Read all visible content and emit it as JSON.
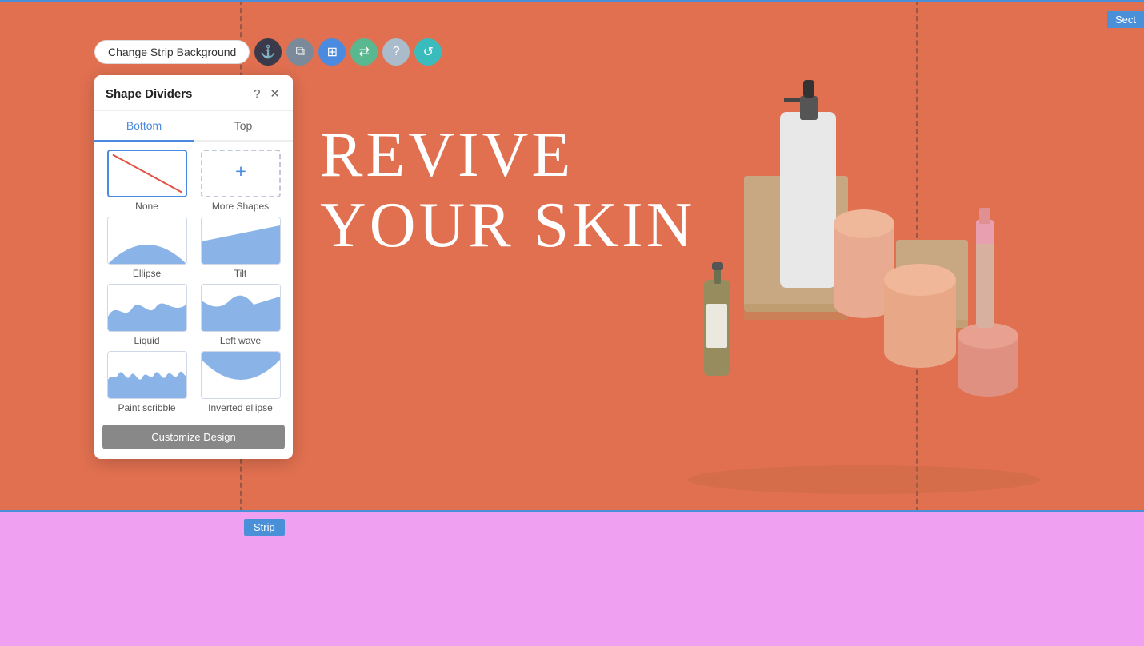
{
  "toolbar": {
    "change_background_label": "Change Strip Background",
    "icons": [
      {
        "name": "anchor-icon",
        "symbol": "⚓",
        "class": "icon-dark"
      },
      {
        "name": "copy-icon",
        "symbol": "⧉",
        "class": "icon-gray"
      },
      {
        "name": "crop-icon",
        "symbol": "⊞",
        "class": "icon-blue"
      },
      {
        "name": "swap-icon",
        "symbol": "⇄",
        "class": "icon-green"
      },
      {
        "name": "help-icon",
        "symbol": "?",
        "class": "icon-light-gray"
      },
      {
        "name": "refresh-icon",
        "symbol": "↺",
        "class": "icon-teal"
      }
    ]
  },
  "panel": {
    "title": "Shape Dividers",
    "tabs": [
      {
        "label": "Bottom",
        "active": true
      },
      {
        "label": "Top",
        "active": false
      }
    ],
    "shapes": [
      {
        "id": "none",
        "label": "None",
        "selected": true,
        "type": "none"
      },
      {
        "id": "more-shapes",
        "label": "More Shapes",
        "selected": false,
        "type": "more"
      },
      {
        "id": "ellipse",
        "label": "Ellipse",
        "selected": false,
        "type": "ellipse"
      },
      {
        "id": "tilt",
        "label": "Tilt",
        "selected": false,
        "type": "tilt"
      },
      {
        "id": "liquid",
        "label": "Liquid",
        "selected": false,
        "type": "liquid"
      },
      {
        "id": "left-wave",
        "label": "Left wave",
        "selected": false,
        "type": "leftwave"
      },
      {
        "id": "paint-scribble",
        "label": "Paint scribble",
        "selected": false,
        "type": "paintscribble"
      },
      {
        "id": "inverted-ellipse",
        "label": "Inverted ellipse",
        "selected": false,
        "type": "invertedellipse"
      }
    ],
    "customize_btn_label": "Customize Design"
  },
  "hero": {
    "line1": "REVIVE",
    "line2": "YOUR SKIN"
  },
  "labels": {
    "strip": "Strip",
    "sect": "Sect"
  }
}
